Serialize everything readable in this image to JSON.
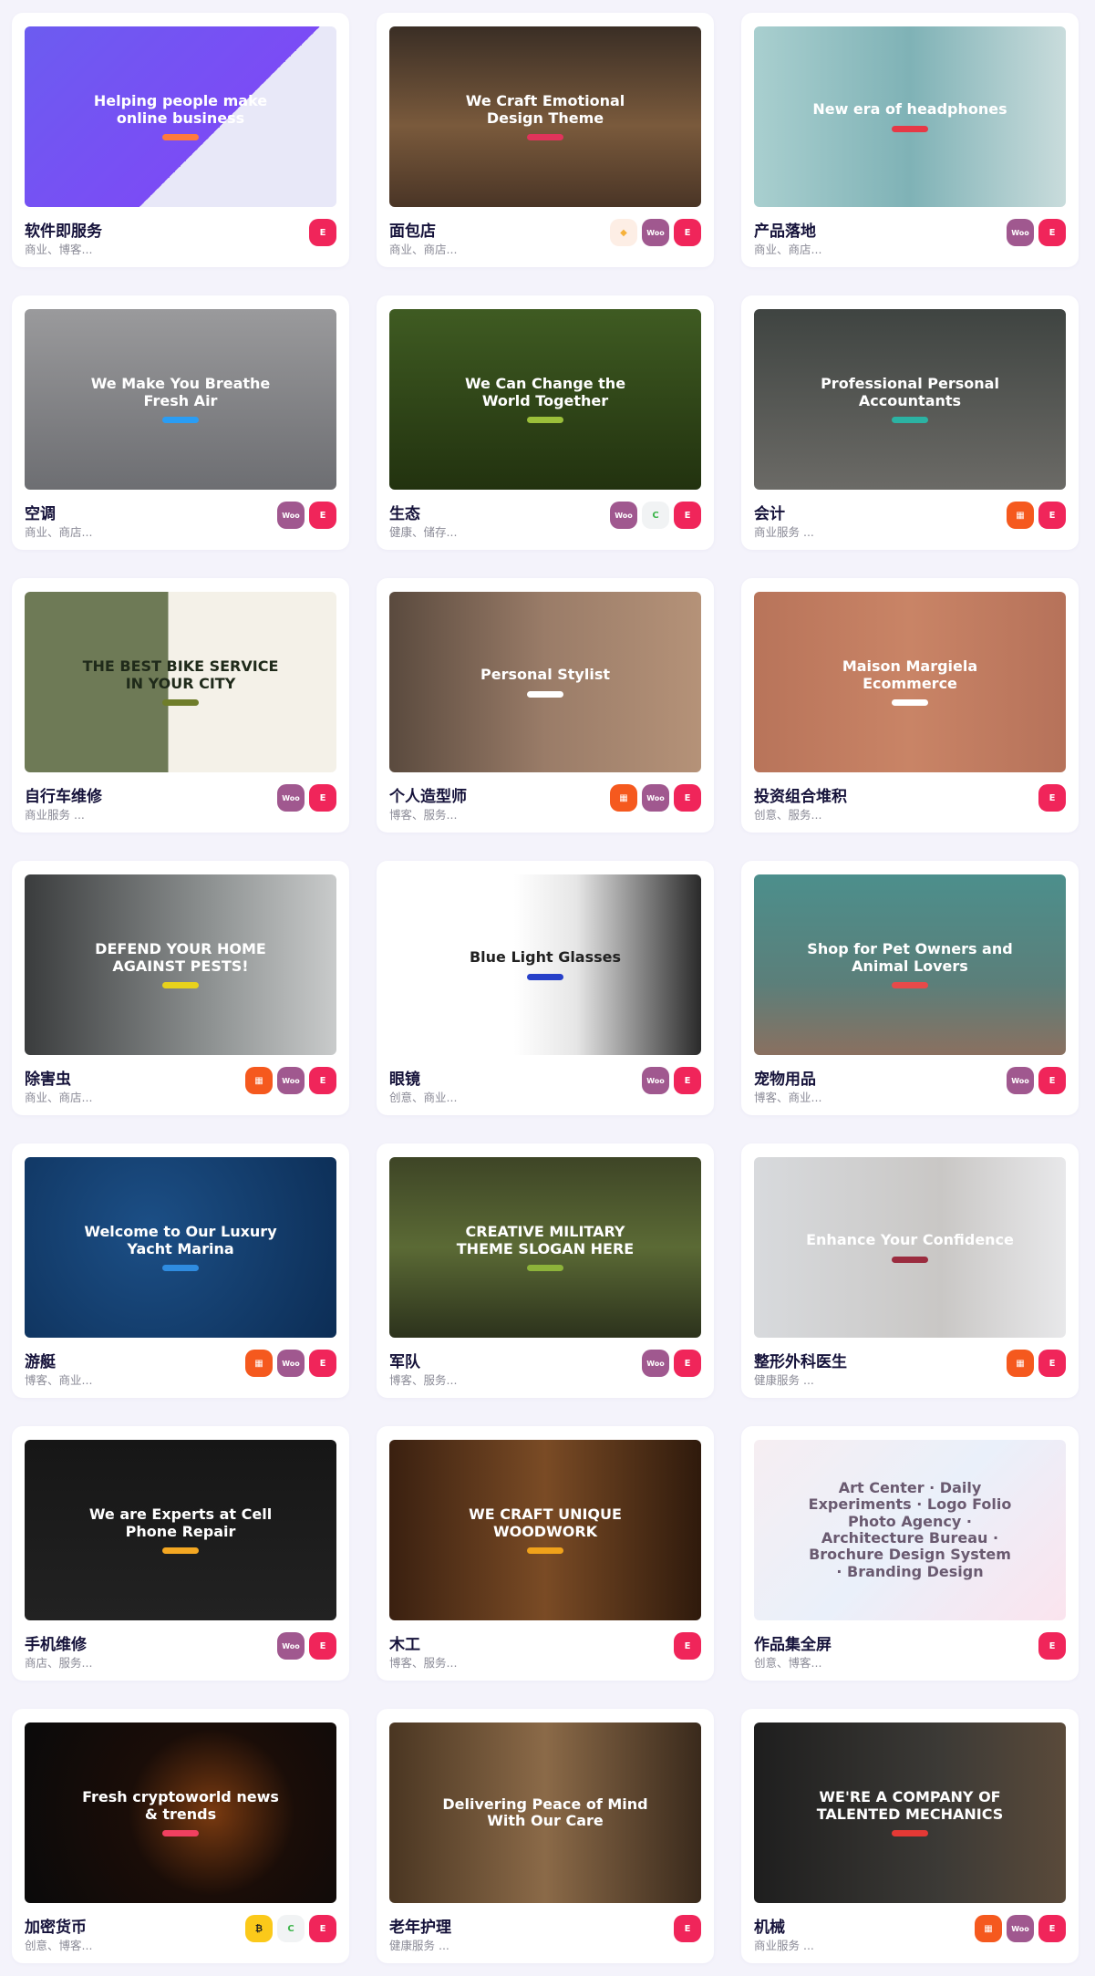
{
  "badge_styles": {
    "elementor": {
      "bg": "#f0255a",
      "glyph": "E"
    },
    "woocommerce": {
      "bg": "#a0588f",
      "glyph": "Woo"
    },
    "sketch": {
      "bg": "#fdeee5",
      "glyph": "◆",
      "fg": "#f6b13a"
    },
    "calendar": {
      "bg": "#f5591e",
      "glyph": "▦"
    },
    "revslider": {
      "bg": "#f1f3f4",
      "glyph": "C",
      "fg": "#3cb54a"
    },
    "bitcoin": {
      "bg": "#fbc91a",
      "glyph": "₿",
      "fg": "#222"
    }
  },
  "cards": [
    {
      "title": "软件即服务",
      "tags": "商业、博客...",
      "hero": "Helping people make online business",
      "bg": "linear-gradient(135deg,#6c5cf0,#7b4cf5 60%,#e8e8f8 60%)",
      "fg": "#fff",
      "accent": "#ff7a3d",
      "badges": [
        "elementor"
      ]
    },
    {
      "title": "面包店",
      "tags": "商业、商店...",
      "hero": "We Craft Emotional Design Theme",
      "bg": "linear-gradient(180deg,#3a2e25,#7a5a3c 55%,#4a3526)",
      "fg": "#fff",
      "accent": "#e0345b",
      "badges": [
        "sketch",
        "woocommerce",
        "elementor"
      ]
    },
    {
      "title": "产品落地",
      "tags": "商业、商店...",
      "hero": "New era of headphones",
      "bg": "linear-gradient(90deg,#a9cfcf,#7fb2b6 50%,#c9dcdc)",
      "fg": "#fff",
      "accent": "#e63946",
      "badges": [
        "woocommerce",
        "elementor"
      ]
    },
    {
      "title": "空调",
      "tags": "商业、商店...",
      "hero": "We Make You Breathe Fresh Air",
      "bg": "linear-gradient(180deg,#9a9a9c,#6d6e72)",
      "fg": "#fff",
      "accent": "#2a9df4",
      "badges": [
        "woocommerce",
        "elementor"
      ]
    },
    {
      "title": "生态",
      "tags": "健康、储存...",
      "hero": "We Can Change the World Together",
      "bg": "linear-gradient(180deg,#3f5b22,#22320f)",
      "fg": "#fff",
      "accent": "#9bbf3a",
      "badges": [
        "woocommerce",
        "revslider",
        "elementor"
      ]
    },
    {
      "title": "会计",
      "tags": "商业服务 ...",
      "hero": "Professional Personal Accountants",
      "bg": "linear-gradient(180deg,#3f4441,#6b6a66)",
      "fg": "#fff",
      "accent": "#2bb3a3",
      "badges": [
        "calendar",
        "elementor"
      ]
    },
    {
      "title": "自行车维修",
      "tags": "商业服务 ...",
      "hero": "THE BEST BIKE SERVICE IN YOUR CITY",
      "bg": "linear-gradient(90deg,#6e7a56 0 46%,#f4f1e8 46%)",
      "fg": "#1f2a1a",
      "accent": "#6f7d2a",
      "badges": [
        "woocommerce",
        "elementor"
      ]
    },
    {
      "title": "个人造型师",
      "tags": "博客、服务...",
      "hero": "Personal Stylist",
      "bg": "linear-gradient(90deg,#5a4a3e,#9a7c68 50%,#b59278)",
      "fg": "#fff",
      "accent": "#ffffff",
      "badges": [
        "calendar",
        "woocommerce",
        "elementor"
      ]
    },
    {
      "title": "投资组合堆积",
      "tags": "创意、服务...",
      "hero": "Maison Margiela Ecommerce",
      "bg": "linear-gradient(90deg,#b8745a,#c98466 50%,#b6725a)",
      "fg": "#fff",
      "accent": "#ffffff",
      "badges": [
        "elementor"
      ]
    },
    {
      "title": "除害虫",
      "tags": "商业、商店...",
      "hero": "DEFEND YOUR HOME AGAINST PESTS!",
      "bg": "linear-gradient(90deg,#3a3c3d,#8e9292 60%,#c9cbcb)",
      "fg": "#fff",
      "accent": "#e8d21c",
      "badges": [
        "calendar",
        "woocommerce",
        "elementor"
      ]
    },
    {
      "title": "眼镜",
      "tags": "创意、商业...",
      "hero": "Blue Light Glasses",
      "bg": "linear-gradient(90deg,#ffffff 40%,#e6e6e6 60%,#2a2a2a)",
      "fg": "#222",
      "accent": "#2740c9",
      "badges": [
        "woocommerce",
        "elementor"
      ]
    },
    {
      "title": "宠物用品",
      "tags": "博客、商业...",
      "hero": "Shop for Pet Owners and Animal Lovers",
      "bg": "linear-gradient(180deg,#4c8f8c,#5b7f7a 60%,#8a7060)",
      "fg": "#fff",
      "accent": "#e84a4a",
      "badges": [
        "woocommerce",
        "elementor"
      ]
    },
    {
      "title": "游艇",
      "tags": "博客、商业...",
      "hero": "Welcome to Our Luxury Yacht Marina",
      "bg": "radial-gradient(circle at 40% 40%,#1c4f86,#0c2d55)",
      "fg": "#fff",
      "accent": "#2f8ce0",
      "badges": [
        "calendar",
        "woocommerce",
        "elementor"
      ]
    },
    {
      "title": "军队",
      "tags": "博客、服务...",
      "hero": "CREATIVE MILITARY THEME SLOGAN HERE",
      "bg": "linear-gradient(180deg,#3e4526,#5b6a35 50%,#2c321c)",
      "fg": "#fff",
      "accent": "#8db33a",
      "badges": [
        "woocommerce",
        "elementor"
      ]
    },
    {
      "title": "整形外科医生",
      "tags": "健康服务 ...",
      "hero": "Enhance Your Confidence",
      "bg": "linear-gradient(90deg,#d8dadd,#c9c7c5 60%,#e8e8ea)",
      "fg": "#fff",
      "accent": "#9b2c3f",
      "badges": [
        "calendar",
        "elementor"
      ]
    },
    {
      "title": "手机维修",
      "tags": "商店、服务...",
      "hero": "We are Experts at Cell Phone Repair",
      "bg": "linear-gradient(180deg,#161616,#222)",
      "fg": "#fff",
      "accent": "#f3a722",
      "badges": [
        "woocommerce",
        "elementor"
      ]
    },
    {
      "title": "木工",
      "tags": "博客、服务...",
      "hero": "WE CRAFT UNIQUE WOODWORK",
      "bg": "linear-gradient(90deg,#3a2010,#7a4b25 50%,#2f1a0c)",
      "fg": "#fff",
      "accent": "#f0a21a",
      "badges": [
        "elementor"
      ]
    },
    {
      "title": "作品集全屏",
      "tags": "创意、博客...",
      "hero": "Art Center · Daily Experiments · Logo Folio Photo Agency · Architecture Bureau · Brochure Design System · Branding Design",
      "bg": "linear-gradient(135deg,#f6eef2,#eaf0fa 50%,#fbe4ee)",
      "fg": "#6a5a70",
      "accent": "",
      "badges": [
        "elementor"
      ]
    },
    {
      "title": "加密货币",
      "tags": "创意、博客...",
      "hero": "Fresh cryptoworld news & trends",
      "bg": "radial-gradient(circle at 60% 50%,#7a3a10,#1a0d08 40%,#0a0a0a)",
      "fg": "#fff",
      "accent": "#f04060",
      "badges": [
        "bitcoin",
        "revslider",
        "elementor"
      ]
    },
    {
      "title": "老年护理",
      "tags": "健康服务 ...",
      "hero": "Delivering Peace of Mind With Our Care",
      "bg": "linear-gradient(90deg,#4a3622,#8b6a48 50%,#3a2a1c)",
      "fg": "#fff",
      "accent": "",
      "badges": [
        "elementor"
      ]
    },
    {
      "title": "机械",
      "tags": "商业服务 ...",
      "hero": "WE'RE A COMPANY OF TALENTED MECHANICS",
      "bg": "linear-gradient(90deg,#1e1e1e,#3c3a36 60%,#5a4a3a)",
      "fg": "#fff",
      "accent": "#e53935",
      "badges": [
        "calendar",
        "woocommerce",
        "elementor"
      ]
    }
  ]
}
